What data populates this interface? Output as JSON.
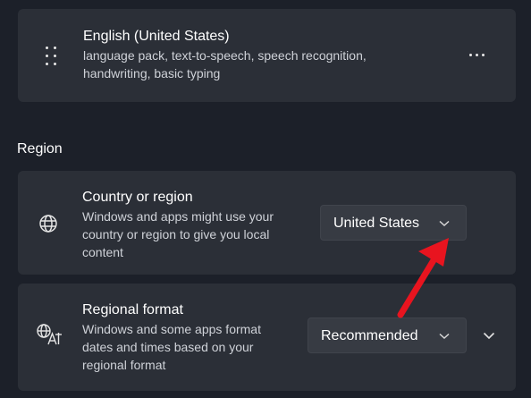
{
  "language": {
    "name": "English (United States)",
    "features_line1": "language pack, text-to-speech, speech recognition,",
    "features_line2": "handwriting, basic typing",
    "icons": {
      "drag": "drag-handle-icon",
      "more": "more-options-icon"
    }
  },
  "region": {
    "heading": "Region",
    "country": {
      "title": "Country or region",
      "desc_line1": "Windows and apps might use your",
      "desc_line2": "country or region to give you local",
      "desc_line3": "content",
      "selected": "United States",
      "icon": "globe-icon"
    },
    "format": {
      "title": "Regional format",
      "desc_line1": "Windows and some apps format",
      "desc_line2": "dates and times based on your",
      "desc_line3": "regional format",
      "selected": "Recommended",
      "icon": "language-format-icon"
    }
  },
  "annotation": {
    "arrow_color": "#e8141f"
  }
}
